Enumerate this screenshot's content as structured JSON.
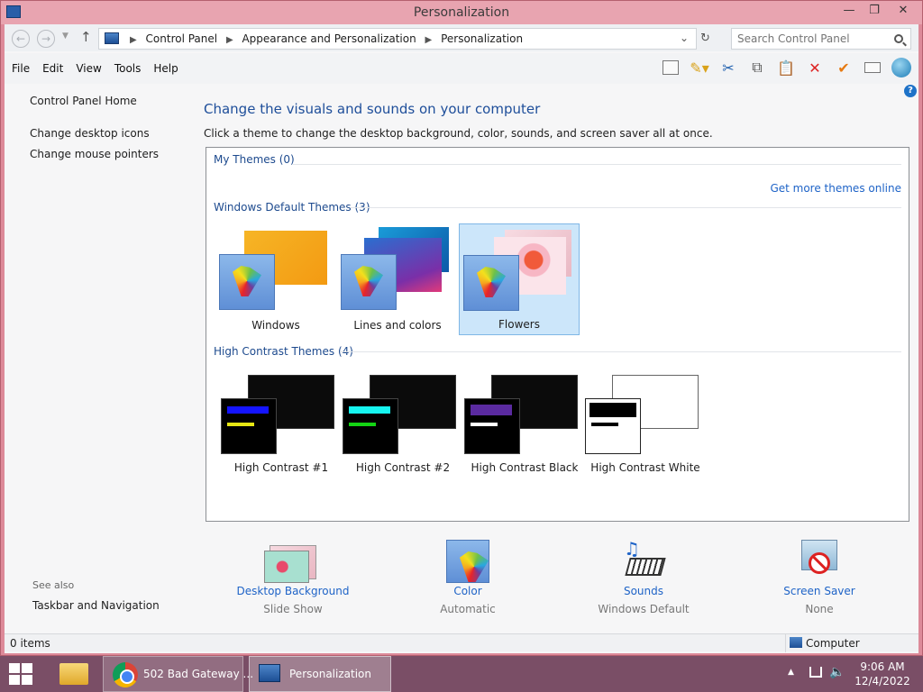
{
  "window": {
    "title": "Personalization",
    "controls": {
      "minimize": "—",
      "maximize": "❐",
      "close": "✕"
    }
  },
  "address": {
    "crumbs": [
      "Control Panel",
      "Appearance and Personalization",
      "Personalization"
    ],
    "search_placeholder": "Search Control Panel"
  },
  "menu": [
    "File",
    "Edit",
    "View",
    "Tools",
    "Help"
  ],
  "toolbar": {
    "icons": [
      "pane-icon",
      "properties-icon",
      "cut-icon",
      "copy-icon",
      "paste-icon",
      "delete-icon",
      "check-icon",
      "rename-icon",
      "globe-icon"
    ],
    "help_glyph": "?"
  },
  "sidebar": {
    "links": [
      "Control Panel Home",
      "Change desktop icons",
      "Change mouse pointers"
    ],
    "see_also": "See also",
    "see_also_links": [
      "Taskbar and Navigation"
    ]
  },
  "main": {
    "title": "Change the visuals and sounds on your computer",
    "description": "Click a theme to change the desktop background, color, sounds, and screen saver all at once.",
    "my_themes": "My Themes (0)",
    "more_themes": "Get more themes online",
    "default_themes": {
      "heading": "Windows Default Themes (3)",
      "items": [
        {
          "name": "Windows",
          "selected": false,
          "colors": [
            "#f5a623",
            "#f8c33a"
          ]
        },
        {
          "name": "Lines and colors",
          "selected": false,
          "colors": [
            "#1d6fb8",
            "#6a3fa0"
          ]
        },
        {
          "name": "Flowers",
          "selected": true,
          "colors": [
            "#f2c6cf",
            "#e84a6a"
          ]
        }
      ]
    },
    "high_contrast": {
      "heading": "High Contrast Themes (4)",
      "items": [
        {
          "name": "High Contrast #1",
          "front_bg": "#000000",
          "bar1": "#1414ff",
          "bar2": "#e6e614",
          "back": "#000000"
        },
        {
          "name": "High Contrast #2",
          "front_bg": "#000000",
          "bar1": "#16f5f0",
          "bar2": "#14d414",
          "back": "#000000"
        },
        {
          "name": "High Contrast Black",
          "front_bg": "#000000",
          "bar1": "#5a2aa0",
          "bar2": "#ffffff",
          "back": "#000000"
        },
        {
          "name": "High Contrast White",
          "front_bg": "#ffffff",
          "bar1": "#000000",
          "bar2": "#000000",
          "back": "#ffffff"
        }
      ]
    }
  },
  "bottom_bar": [
    {
      "label": "Desktop Background",
      "value": "Slide Show",
      "icon": "desktop-background-icon"
    },
    {
      "label": "Color",
      "value": "Automatic",
      "icon": "color-icon"
    },
    {
      "label": "Sounds",
      "value": "Windows Default",
      "icon": "sounds-icon"
    },
    {
      "label": "Screen Saver",
      "value": "None",
      "icon": "screen-saver-icon"
    }
  ],
  "status": {
    "items": "0 items",
    "location": "Computer"
  },
  "taskbar": {
    "apps": [
      {
        "label": "",
        "icon": "file-explorer-icon"
      },
      {
        "label": "502 Bad Gateway ...",
        "icon": "chrome-icon"
      },
      {
        "label": "Personalization",
        "icon": "control-panel-icon"
      }
    ],
    "time": "9:06 AM",
    "date": "12/4/2022"
  }
}
